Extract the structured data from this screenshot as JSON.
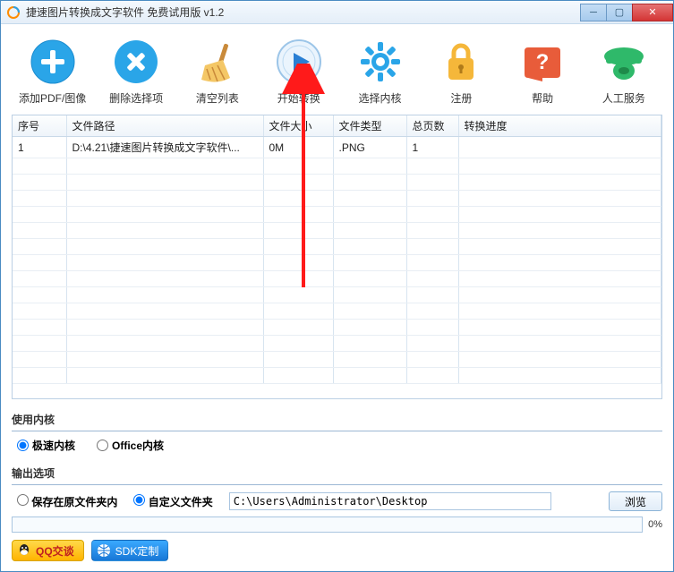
{
  "window": {
    "title": "捷速图片转换成文字软件 免费试用版 v1.2"
  },
  "toolbar": [
    {
      "id": "add",
      "label": "添加PDF/图像"
    },
    {
      "id": "delete",
      "label": "删除选择项"
    },
    {
      "id": "clear",
      "label": "清空列表"
    },
    {
      "id": "start",
      "label": "开始转换"
    },
    {
      "id": "kernel",
      "label": "选择内核"
    },
    {
      "id": "register",
      "label": "注册"
    },
    {
      "id": "help",
      "label": "帮助"
    },
    {
      "id": "service",
      "label": "人工服务"
    }
  ],
  "table": {
    "headers": [
      "序号",
      "文件路径",
      "文件大小",
      "文件类型",
      "总页数",
      "转换进度"
    ],
    "rows": [
      {
        "index": "1",
        "path": "D:\\4.21\\捷速图片转换成文字软件\\...",
        "size": "0M",
        "type": ".PNG",
        "pages": "1",
        "progress": ""
      }
    ]
  },
  "kernel_section": {
    "title": "使用内核",
    "fast": "极速内核",
    "office": "Office内核"
  },
  "output_section": {
    "title": "输出选项",
    "keep_original": "保存在原文件夹内",
    "custom_folder": "自定义文件夹",
    "path": "C:\\Users\\Administrator\\Desktop",
    "browse": "浏览"
  },
  "progress_pct": "0%",
  "footer": {
    "qq": "QQ交谈",
    "sdk": "SDK定制"
  }
}
